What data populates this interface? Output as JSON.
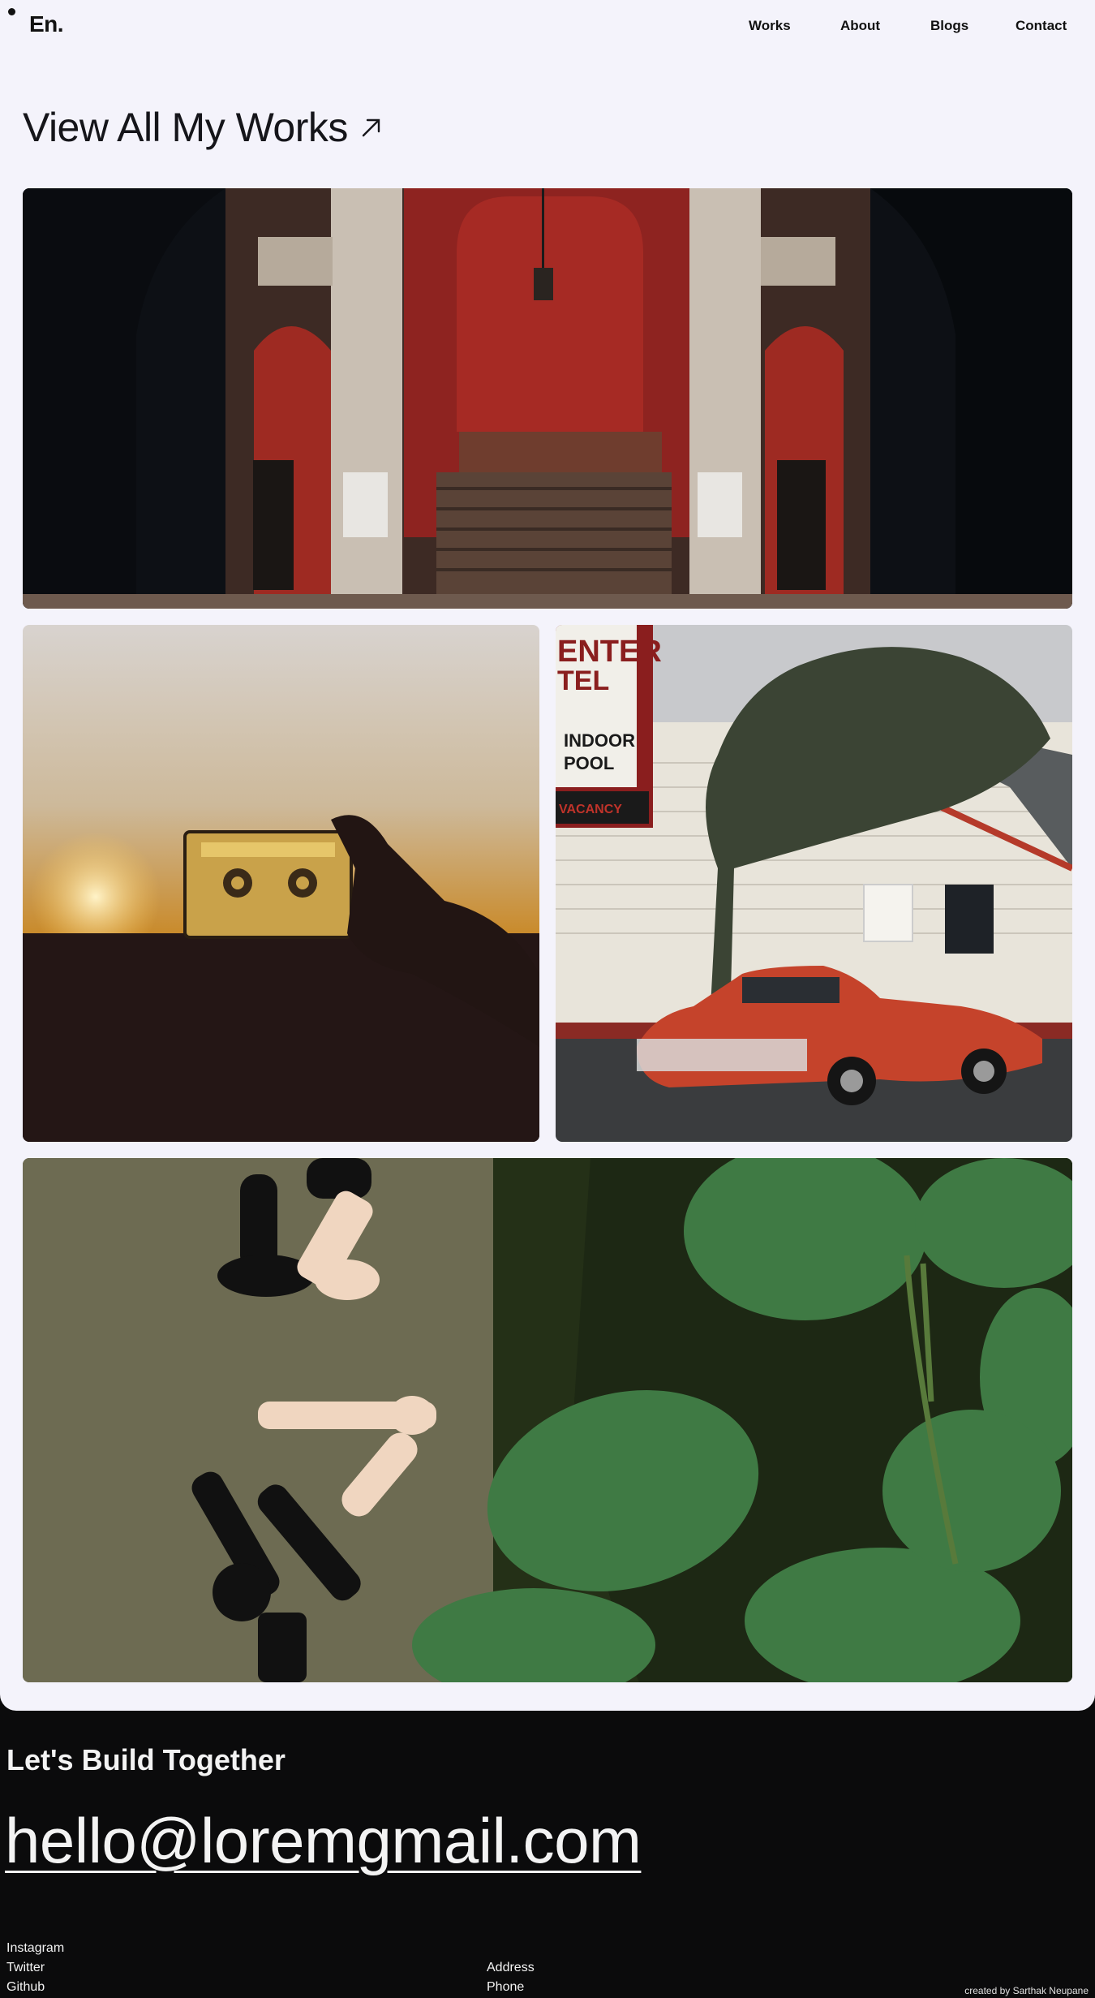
{
  "header": {
    "logo": "En.",
    "nav": [
      "Works",
      "About",
      "Blogs",
      "Contact"
    ]
  },
  "main": {
    "heading": "View All My Works",
    "heading_icon": "arrow-up-right-icon",
    "gallery": [
      {
        "name": "theater-staircase-photo",
        "sign": ""
      },
      {
        "name": "cassette-sunset-photo",
        "sign": ""
      },
      {
        "name": "vintage-red-car-photo",
        "sign_lines": [
          "ENTER",
          "TEL",
          "INDOOR",
          "POOL",
          "VACANCY"
        ]
      },
      {
        "name": "chess-pieces-leaves-photo",
        "sign": ""
      }
    ]
  },
  "footer": {
    "title": "Let's Build Together",
    "email": "hello@loremgmail.com",
    "social": [
      "Instagram",
      "Twitter",
      "Github"
    ],
    "contact": [
      "Address",
      "Phone"
    ],
    "credit": "created by Sarthak Neupane"
  },
  "colors": {
    "page_bg": "#f4f3fb",
    "footer_bg": "#0b0b0c",
    "text_dark": "#111111",
    "text_light": "#f3f3f3"
  }
}
